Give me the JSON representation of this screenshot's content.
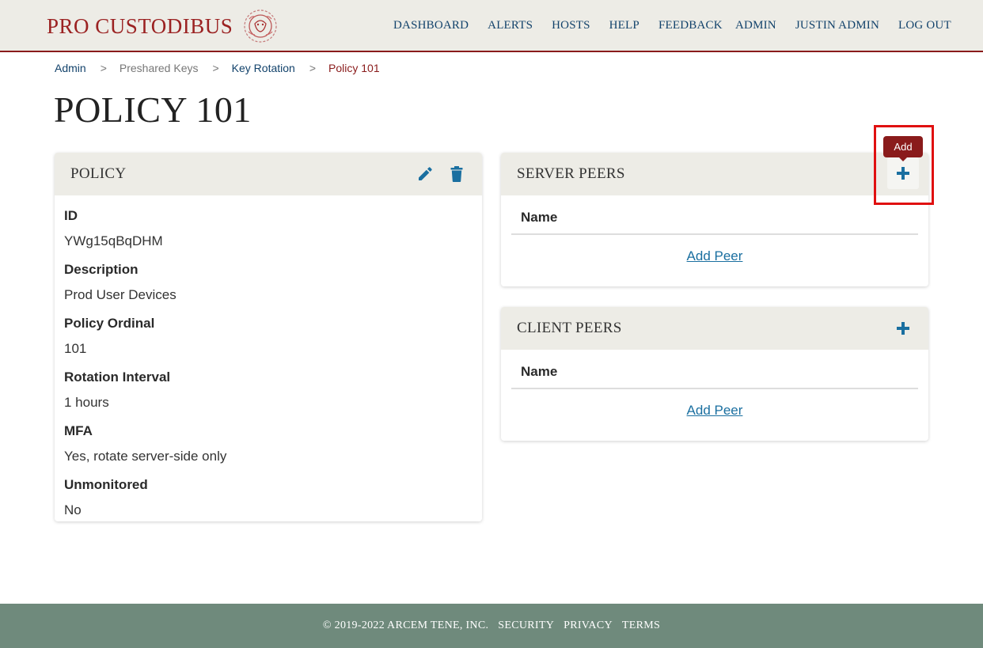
{
  "brand": {
    "name": "PRO CUSTODIBUS",
    "logo_icon": "lion-medallion-icon",
    "color": "#9b2222"
  },
  "nav": {
    "main": [
      "DASHBOARD",
      "ALERTS",
      "HOSTS",
      "HELP",
      "FEEDBACK"
    ],
    "user": [
      "ADMIN",
      "JUSTIN ADMIN",
      "LOG OUT"
    ]
  },
  "breadcrumb": {
    "items": [
      "Admin",
      "Preshared Keys",
      "Key Rotation",
      "Policy 101"
    ],
    "separator": ">"
  },
  "page": {
    "title": "POLICY 101"
  },
  "policy_card": {
    "title": "POLICY",
    "edit_icon": "pencil-icon",
    "delete_icon": "trash-icon",
    "fields": [
      {
        "label": "ID",
        "value": "YWg15qBqDHM"
      },
      {
        "label": "Description",
        "value": "Prod User Devices"
      },
      {
        "label": "Policy Ordinal",
        "value": "101"
      },
      {
        "label": "Rotation Interval",
        "value": "1 hours"
      },
      {
        "label": "MFA",
        "value": "Yes, rotate server-side only"
      },
      {
        "label": "Unmonitored",
        "value": "No"
      }
    ]
  },
  "server_peers": {
    "title": "SERVER PEERS",
    "column": "Name",
    "add_link": "Add Peer",
    "add_icon": "plus-icon"
  },
  "client_peers": {
    "title": "CLIENT PEERS",
    "column": "Name",
    "add_link": "Add Peer",
    "add_icon": "plus-icon"
  },
  "tooltip": {
    "text": "Add"
  },
  "footer": [
    "© 2019-2022 ARCEM TENE, INC.",
    "SECURITY",
    "PRIVACY",
    "TERMS"
  ],
  "colors": {
    "accent_blue": "#1a6fa0",
    "header_bg": "#edece6",
    "footer_bg": "#6f8a7c",
    "highlight": "#e01010"
  }
}
